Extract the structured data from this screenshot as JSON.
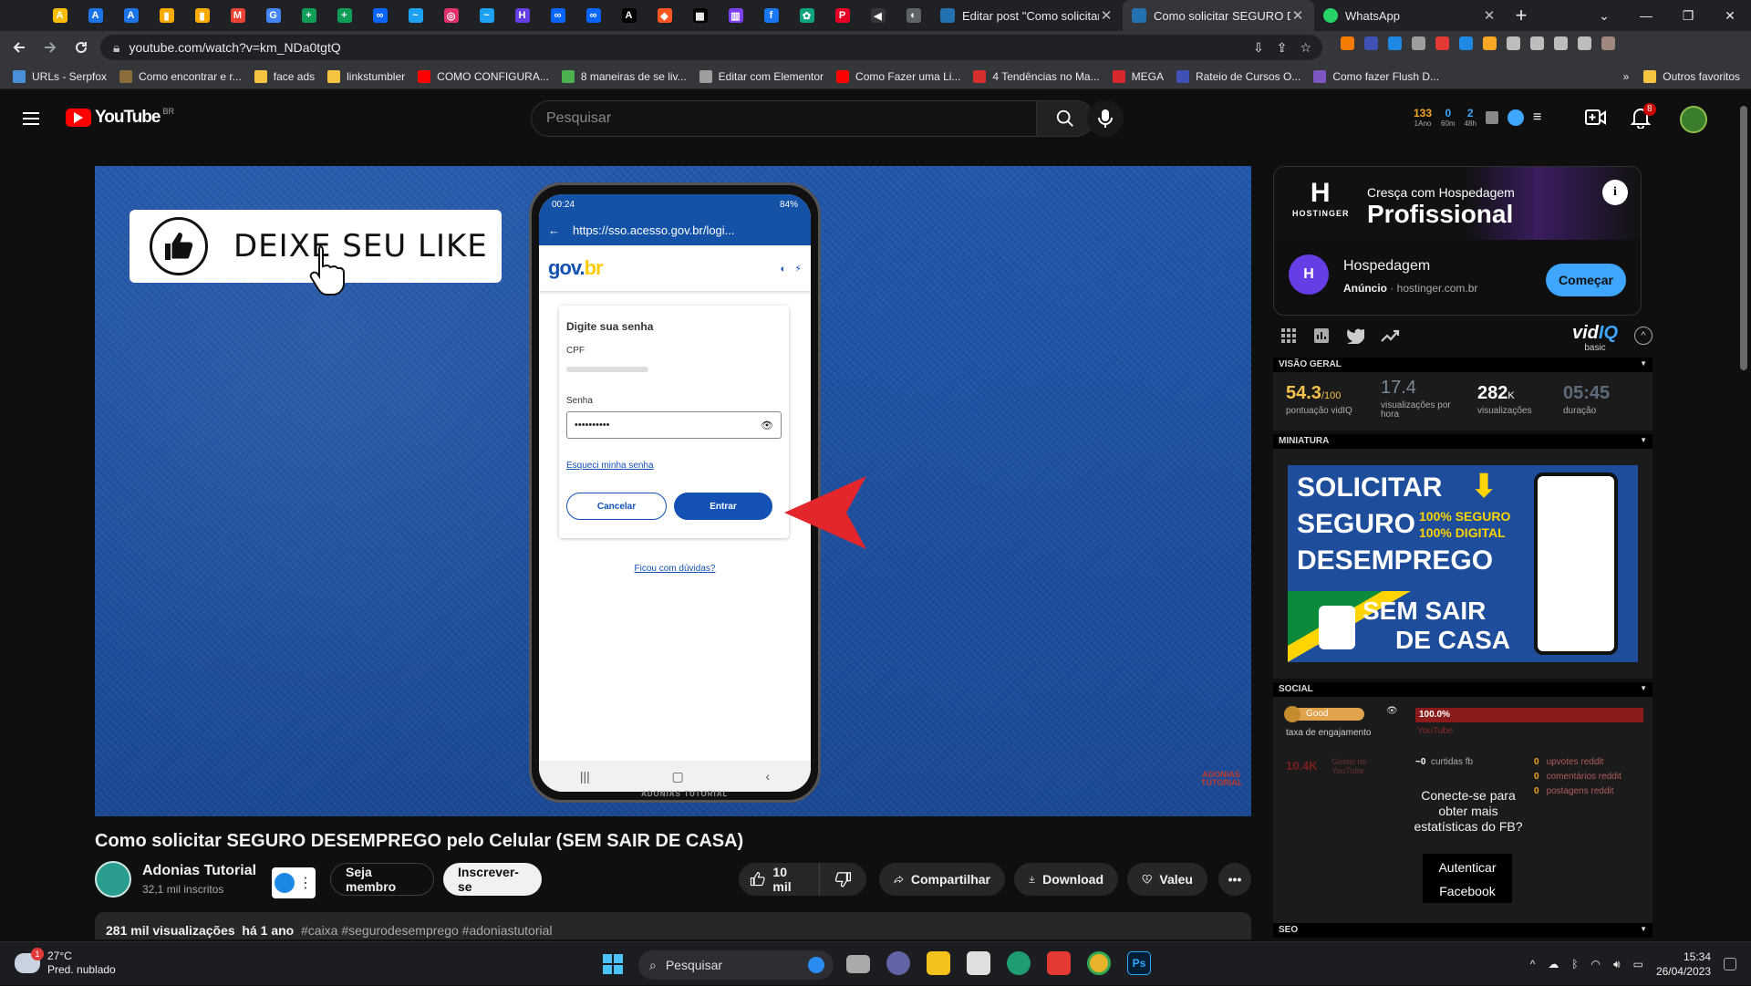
{
  "browser": {
    "pinned_tabs": [
      {
        "name": "google-ads",
        "color": "#fbbc04",
        "glyph": "A"
      },
      {
        "name": "google-ads-2",
        "color": "#1a73e8",
        "glyph": "A"
      },
      {
        "name": "google-ads-3",
        "color": "#1a73e8",
        "glyph": "A"
      },
      {
        "name": "analytics",
        "color": "#f9ab00",
        "glyph": "▮"
      },
      {
        "name": "analytics-2",
        "color": "#f9ab00",
        "glyph": "▮"
      },
      {
        "name": "gmail",
        "color": "#ea4335",
        "glyph": "M"
      },
      {
        "name": "translate",
        "color": "#4285f4",
        "glyph": "G"
      },
      {
        "name": "sheets",
        "color": "#0f9d58",
        "glyph": "+"
      },
      {
        "name": "sheets-2",
        "color": "#0f9d58",
        "glyph": "+"
      },
      {
        "name": "meta",
        "color": "#0866ff",
        "glyph": "∞"
      },
      {
        "name": "bird",
        "color": "#1da1f2",
        "glyph": "~"
      },
      {
        "name": "instagram",
        "color": "#e1306c",
        "glyph": "◎"
      },
      {
        "name": "bird-2",
        "color": "#1da1f2",
        "glyph": "~"
      },
      {
        "name": "hk",
        "color": "#673de6",
        "glyph": "H"
      },
      {
        "name": "meta-2",
        "color": "#0866ff",
        "glyph": "∞"
      },
      {
        "name": "meta-3",
        "color": "#0866ff",
        "glyph": "∞"
      },
      {
        "name": "kiwify",
        "color": "#000000",
        "glyph": "A"
      },
      {
        "name": "fire",
        "color": "#ff5722",
        "glyph": "◆"
      },
      {
        "name": "qr",
        "color": "#000000",
        "glyph": "▦"
      },
      {
        "name": "bars",
        "color": "#7e3ff2",
        "glyph": "▥"
      },
      {
        "name": "facebook",
        "color": "#1877f2",
        "glyph": "f"
      },
      {
        "name": "openai",
        "color": "#10a37f",
        "glyph": "✿"
      },
      {
        "name": "pinterest",
        "color": "#e60023",
        "glyph": "P"
      },
      {
        "name": "audio",
        "color": "#35363a",
        "glyph": "◀"
      },
      {
        "name": "globe",
        "color": "#5f6368",
        "glyph": "◐"
      }
    ],
    "tabs": [
      {
        "label": "Editar post \"Como solicitar",
        "active": false,
        "color": "#2271b1"
      },
      {
        "label": "Como solicitar SEGURO DE",
        "active": true,
        "color": "#2271b1"
      },
      {
        "label": "WhatsApp",
        "active": false,
        "color": "#25d366"
      }
    ],
    "new_tab": "+",
    "url": "youtube.com/watch?v=km_NDa0tgtQ",
    "bookmarks": [
      {
        "label": "URLs - Serpfox",
        "color": "#4a90d9"
      },
      {
        "label": "Como encontrar e r...",
        "color": "#8a6d3b"
      },
      {
        "label": "face ads",
        "color": "#f5c542"
      },
      {
        "label": "linkstumbler",
        "color": "#f5c542"
      },
      {
        "label": "COMO CONFIGURA...",
        "color": "#ff0000"
      },
      {
        "label": "8 maneiras de se liv...",
        "color": "#4caf50"
      },
      {
        "label": "Editar com Elementor",
        "color": "#9e9e9e"
      },
      {
        "label": "Como Fazer uma Li...",
        "color": "#ff0000"
      },
      {
        "label": "4 Tendências no Ma...",
        "color": "#d32f2f"
      },
      {
        "label": "MEGA",
        "color": "#d9272e"
      },
      {
        "label": "Rateio de Cursos O...",
        "color": "#3f51b5"
      },
      {
        "label": "Como fazer Flush D...",
        "color": "#7e57c2"
      }
    ],
    "bookmarks_more": "»",
    "other_bookmarks": "Outros favoritos"
  },
  "youtube": {
    "logo": "YouTube",
    "country": "BR",
    "search_placeholder": "Pesquisar",
    "vidiq_stats": [
      {
        "n": "133",
        "l": "1Ano",
        "color": "orange"
      },
      {
        "n": "0",
        "l": "60m",
        "color": "blue"
      },
      {
        "n": "2",
        "l": "48h",
        "color": "blue"
      }
    ],
    "notifications": "8",
    "video": {
      "like_card": "DEIXE SEU LIKE",
      "phone": {
        "time": "00:24",
        "status_right": "84%",
        "url": "https://sso.acesso.gov.br/logi...",
        "gov_logo_a": "gov.",
        "gov_logo_b": "br",
        "heading": "Digite sua senha",
        "cpf_label": "CPF",
        "password_label": "Senha",
        "password_value": "••••••••••",
        "forgot": "Esqueci minha senha",
        "cancel": "Cancelar",
        "enter": "Entrar",
        "doubts": "Ficou com dúvidas?",
        "brand": "ADONIAS TUTORIAL"
      },
      "watermark": "ADONIAS TUTORIAL"
    },
    "title": "Como solicitar SEGURO DESEMPREGO pelo Celular (SEM SAIR DE CASA)",
    "channel": {
      "name": "Adonias Tutorial",
      "subs": "32,1 mil inscritos"
    },
    "buttons": {
      "join": "Seja membro",
      "subscribe": "Inscrever-se",
      "likes": "10 mil",
      "share": "Compartilhar",
      "download": "Download",
      "thanks": "Valeu"
    },
    "description": {
      "views": "281 mil visualizações",
      "age": "há 1 ano",
      "tags": "#caixa #segurodesemprego #adoniastutorial"
    }
  },
  "sidebar": {
    "ad": {
      "brand": "HOSTINGER",
      "headline_small": "Cresça com Hospedagem",
      "headline_big": "Profissional",
      "title": "Hospedagem",
      "label": "Anúncio",
      "domain": "hostinger.com.br",
      "cta": "Começar"
    },
    "vidiq": {
      "logo_a": "vid",
      "logo_b": "IQ",
      "plan": "basic",
      "sections": {
        "overview": "VISÃO GERAL",
        "thumbnail": "MINIATURA",
        "social": "SOCIAL",
        "seo": "SEO"
      },
      "overview": [
        {
          "value": "54.3",
          "suffix": "/100",
          "label": "pontuação vidIQ"
        },
        {
          "value": "17.4",
          "suffix": "",
          "label": "visualizações por hora"
        },
        {
          "value": "282",
          "suffix": "K",
          "label": "visualizações"
        },
        {
          "value": "05:45",
          "suffix": "",
          "label": "duração"
        }
      ],
      "thumbnail": {
        "line1": "SOLICITAR",
        "line2": "SEGURO",
        "line3": "DESEMPREGO",
        "badge1": "100% SEGURO",
        "badge2": "100% DIGITAL",
        "line4": "SEM SAIR",
        "line5": "DE CASA"
      },
      "social": {
        "rating": "Good",
        "engagement_label": "taxa de engajamento",
        "youtube_pct": "100.0%",
        "youtube_label": "YouTube",
        "likes": "10.4K",
        "likes_label": "Gostei no YouTube",
        "fb_shares": "~0",
        "fb_label": "curtidas fb",
        "reddit": [
          {
            "n": "0",
            "l": "upvotes reddit"
          },
          {
            "n": "0",
            "l": "comentários reddit"
          },
          {
            "n": "0",
            "l": "postagens reddit"
          }
        ],
        "fb_prompt": "Conecte-se para obter mais estatísticas do FB?",
        "fb_auth_1": "Autenticar",
        "fb_auth_2": "Facebook"
      }
    }
  },
  "taskbar": {
    "weather_temp": "27°C",
    "weather_desc": "Pred. nublado",
    "weather_badge": "1",
    "search": "Pesquisar",
    "time": "15:34",
    "date": "26/04/2023"
  }
}
